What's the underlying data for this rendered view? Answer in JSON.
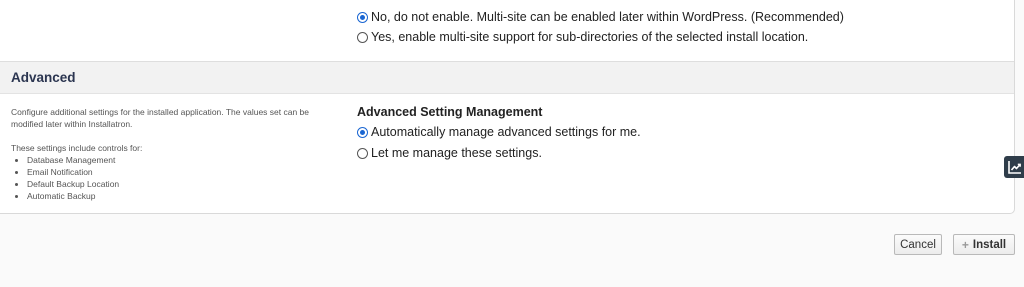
{
  "multisite": {
    "options": [
      {
        "label": "No, do not enable. Multi-site can be enabled later within WordPress. (Recommended)",
        "selected": true
      },
      {
        "label": "Yes, enable multi-site support for sub-directories of the selected install location.",
        "selected": false
      }
    ]
  },
  "advanced": {
    "title": "Advanced",
    "description": "Configure additional settings for the installed application. The values set can be modified later within Installatron.",
    "controls_intro": "These settings include controls for:",
    "controls": [
      "Database Management",
      "Email Notification",
      "Default Backup Location",
      "Automatic Backup"
    ],
    "management_title": "Advanced Setting Management",
    "management_options": [
      {
        "label": "Automatically manage advanced settings for me.",
        "selected": true
      },
      {
        "label": "Let me manage these settings.",
        "selected": false
      }
    ]
  },
  "side_tab": {
    "icon": "chart-trend-icon"
  },
  "actions": {
    "cancel_label": "Cancel",
    "install_label": "Install",
    "install_icon": "plus-icon"
  },
  "colors": {
    "radio_selected": "#1a66d2",
    "section_title": "#2b3550",
    "side_tab_bg": "#2f3d4a"
  }
}
